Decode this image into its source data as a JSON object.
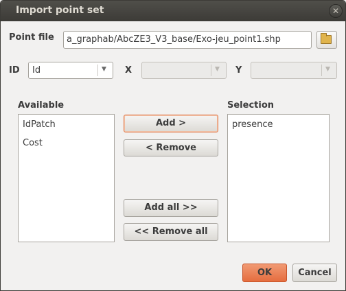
{
  "window": {
    "title": "Import point set",
    "close_glyph": "✕"
  },
  "point_file": {
    "label": "Point file",
    "value": "a_graphab/AbcZE3_V3_base/Exo-jeu_point1.shp",
    "browse_icon": "folder-open-icon"
  },
  "fields": {
    "id_label": "ID",
    "id_value": "Id",
    "x_label": "X",
    "x_value": "",
    "y_label": "Y",
    "y_value": ""
  },
  "available": {
    "label": "Available",
    "items": [
      "IdPatch",
      "Cost"
    ]
  },
  "selection": {
    "label": "Selection",
    "items": [
      "presence"
    ]
  },
  "buttons": {
    "add": "Add >",
    "remove": "< Remove",
    "add_all": "Add all >>",
    "remove_all": "<< Remove all",
    "ok": "OK",
    "cancel": "Cancel"
  },
  "colors": {
    "accent": "#e56d3f",
    "titlebar": "#3c3b37"
  }
}
